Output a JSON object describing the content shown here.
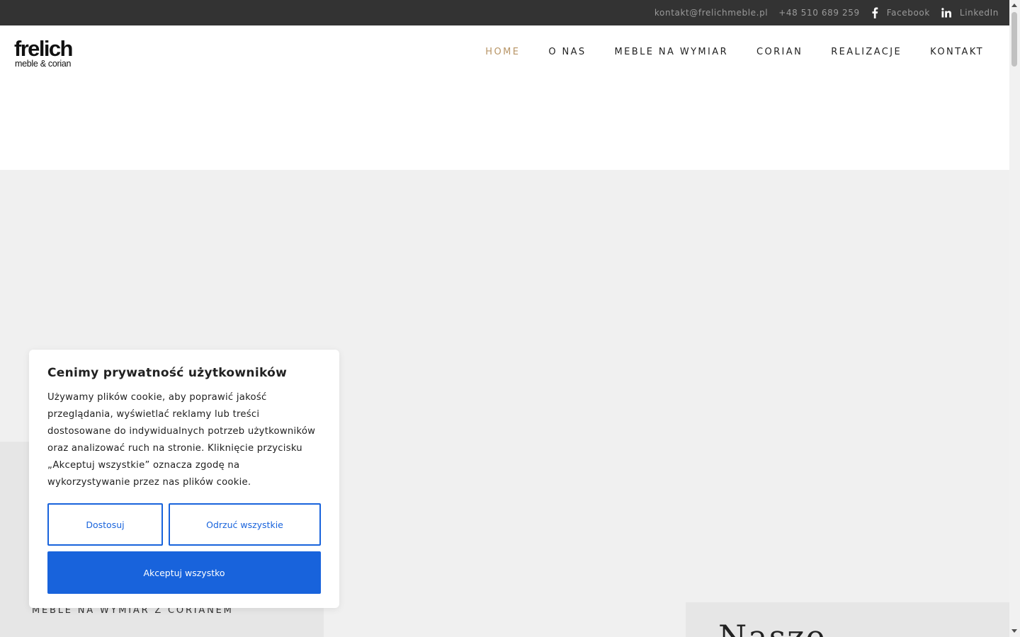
{
  "topbar": {
    "email": "kontakt@frelichmeble.pl",
    "phone": "+48 510 689 259",
    "facebook_label": "Facebook",
    "linkedin_label": "LinkedIn",
    "facebook_icon": "facebook-icon",
    "linkedin_icon": "linkedin-icon"
  },
  "logo": {
    "main": "frelich",
    "sub": "meble & corian"
  },
  "nav": {
    "items": [
      {
        "label": "HOME",
        "active": true
      },
      {
        "label": "O NAS"
      },
      {
        "label": "MEBLE NA WYMIAR"
      },
      {
        "label": "CORIAN"
      },
      {
        "label": "REALIZACJE"
      },
      {
        "label": "KONTAKT"
      }
    ],
    "active_color": "#b89566"
  },
  "hero": {
    "caption": "MEBLE NA WYMIAR Z CORIANEM",
    "heading": "Nasze"
  },
  "cookie": {
    "title": "Cenimy prywatność użytkowników",
    "text": "Używamy plików cookie, aby poprawić jakość przeglądania, wyświetlać reklamy lub treści dostosowane do indywidualnych potrzeb użytkowników oraz analizować ruch na stronie. Kliknięcie przycisku „Akceptuj wszystkie” oznacza zgodę na wykorzystywanie przez nas plików cookie.",
    "customize_label": "Dostosuj",
    "reject_label": "Odrzuć wszystkie",
    "accept_label": "Akceptuj wszystko",
    "accent_color": "#1863dc"
  }
}
